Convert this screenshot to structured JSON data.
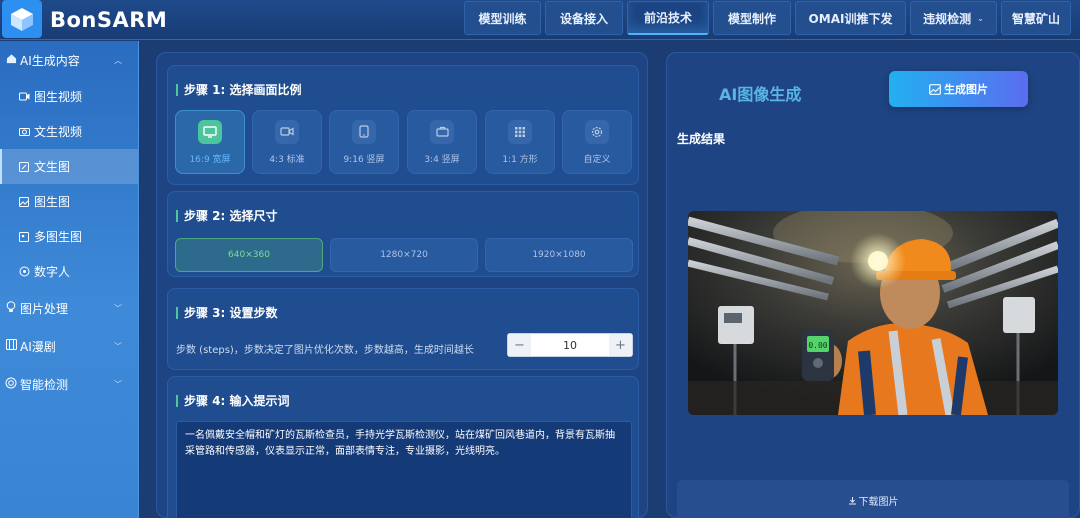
{
  "header": {
    "brand": "BonSARM",
    "nav": [
      {
        "label": "模型训练",
        "active": false
      },
      {
        "label": "设备接入",
        "active": false
      },
      {
        "label": "前沿技术",
        "active": true
      },
      {
        "label": "模型制作",
        "active": false
      },
      {
        "label": "OMAI训推下发",
        "active": false
      },
      {
        "label": "违规检测",
        "active": false,
        "caret": "⌄"
      },
      {
        "label": "智慧矿山",
        "active": false
      }
    ]
  },
  "sidebar": {
    "groups": [
      {
        "label": "AI生成内容",
        "icon": "home-icon",
        "chevron": "︿"
      },
      {
        "label": "图片处理",
        "icon": "bulb-icon",
        "chevron": "﹀"
      },
      {
        "label": "AI漫剧",
        "icon": "film-icon",
        "chevron": "﹀"
      },
      {
        "label": "智能检测",
        "icon": "target-icon",
        "chevron": "﹀"
      }
    ],
    "items": [
      {
        "label": "图生视频",
        "icon": "video-icon"
      },
      {
        "label": "文生视频",
        "icon": "camera-icon"
      },
      {
        "label": "文生图",
        "icon": "edit-image-icon",
        "active": true
      },
      {
        "label": "图生图",
        "icon": "image-icon"
      },
      {
        "label": "多图生图",
        "icon": "multi-image-icon"
      },
      {
        "label": "数字人",
        "icon": "circle-play-icon"
      }
    ]
  },
  "steps": {
    "step1": {
      "title": "步骤 1: 选择画面比例",
      "ratios": [
        {
          "label": "16:9 宽屏",
          "icon": "monitor-icon",
          "active": true
        },
        {
          "label": "4:3 标准",
          "icon": "camera-video-icon",
          "active": false
        },
        {
          "label": "9:16 竖屏",
          "icon": "phone-icon",
          "active": false
        },
        {
          "label": "3:4 竖屏",
          "icon": "briefcase-icon",
          "active": false
        },
        {
          "label": "1:1 方形",
          "icon": "grid-icon",
          "active": false
        },
        {
          "label": "自定义",
          "icon": "settings-icon",
          "active": false
        }
      ]
    },
    "step2": {
      "title": "步骤 2: 选择尺寸",
      "sizes": [
        {
          "label": "640×360",
          "active": true
        },
        {
          "label": "1280×720",
          "active": false
        },
        {
          "label": "1920×1080",
          "active": false
        }
      ]
    },
    "step3": {
      "title": "步骤 3: 设置步数",
      "description": "步数 (steps)，步数决定了图片优化次数，步数越高，生成时间越长",
      "value": "10",
      "minus": "−",
      "plus": "+"
    },
    "step4": {
      "title": "步骤 4: 输入提示词",
      "prompt": "一名佩戴安全帽和矿灯的瓦斯检查员，手持光学瓦斯检测仪，站在煤矿回风巷道内，背景有瓦斯抽采管路和传感器，仪表显示正常，面部表情专注，专业摄影，光线明亮。"
    }
  },
  "right": {
    "title": "AI图像生成",
    "generate_label": "生成图片",
    "result_title": "生成结果",
    "download_label": "下载图片",
    "photo_readout": "0.00"
  },
  "colors": {
    "accent": "#4fb1ff",
    "active_green": "#4cc59c",
    "panel": "#1e4483",
    "sidebar_gradient_top": "#2a6cc0"
  }
}
